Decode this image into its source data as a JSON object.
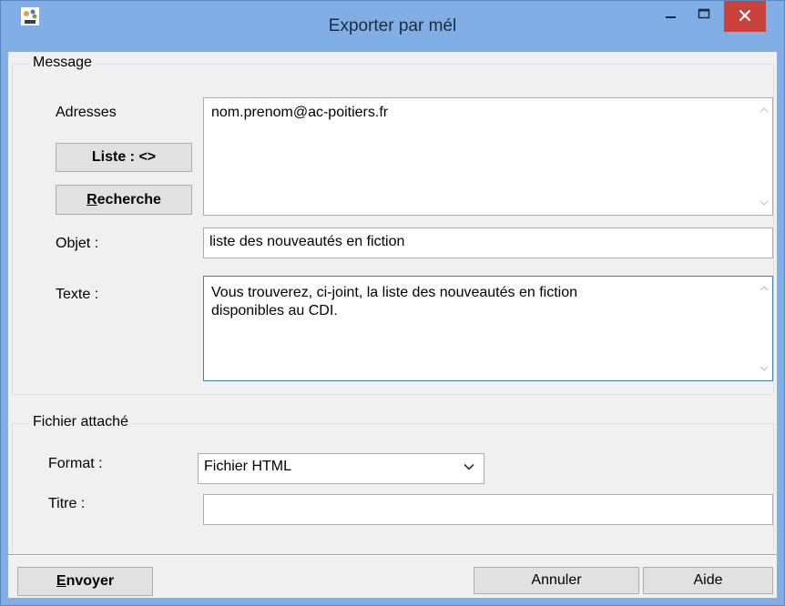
{
  "window": {
    "title": "Exporter par mél"
  },
  "message_group": {
    "title": "Message",
    "addresses_label": "Adresses",
    "addresses_value": "nom.prenom@ac-poitiers.fr",
    "list_button": "Liste : <>",
    "search_button_first": "R",
    "search_button_rest": "echerche",
    "subject_label": "Objet :",
    "subject_value": "liste des nouveautés en fiction",
    "text_label": "Texte :",
    "text_line1": "Vous trouverez, ci-joint, la liste des nouveautés en fiction",
    "text_line2": "disponibles au CDI."
  },
  "attachment_group": {
    "title": "Fichier attaché",
    "format_label": "Format :",
    "format_value": "Fichier HTML",
    "title_label": "Titre :",
    "title_value": ""
  },
  "footer": {
    "send_first": "E",
    "send_rest": "nvoyer",
    "cancel": "Annuler",
    "help": "Aide"
  },
  "colors": {
    "titlebar": "#82aee6",
    "close_button": "#c8413a",
    "dialog_bg": "#f0f0f0",
    "focus_border": "#3c7fb1"
  },
  "icons": {
    "app": "app-logo-icon",
    "minimize": "minimize-icon",
    "maximize": "maximize-icon",
    "close": "close-icon"
  }
}
